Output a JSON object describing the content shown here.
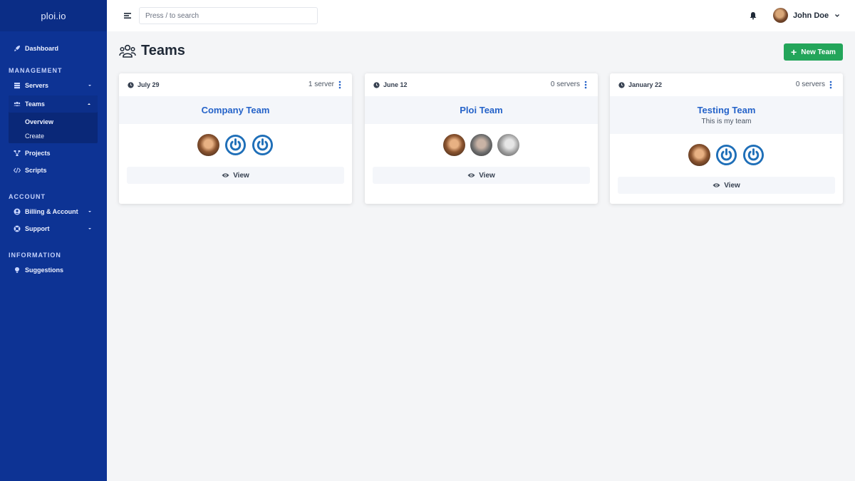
{
  "brand": "ploi.io",
  "search": {
    "placeholder": "Press / to search"
  },
  "user": {
    "name": "John Doe"
  },
  "sidebar": {
    "dashboard": "Dashboard",
    "sections": {
      "management": "MANAGEMENT",
      "account": "ACCOUNT",
      "information": "INFORMATION"
    },
    "servers": "Servers",
    "teams": "Teams",
    "teams_sub": [
      "Overview",
      "Create"
    ],
    "projects": "Projects",
    "scripts": "Scripts",
    "billing": "Billing & Account",
    "support": "Support",
    "suggestions": "Suggestions"
  },
  "page": {
    "title": "Teams",
    "new_button": "New Team"
  },
  "cards": [
    {
      "date": "July 29",
      "servers": "1 server",
      "name": "Company Team",
      "description": "",
      "view": "View",
      "members": [
        "photo",
        "power",
        "power"
      ]
    },
    {
      "date": "June 12",
      "servers": "0 servers",
      "name": "Ploi Team",
      "description": "",
      "view": "View",
      "members": [
        "photo",
        "photo",
        "photo"
      ]
    },
    {
      "date": "January 22",
      "servers": "0 servers",
      "name": "Testing Team",
      "description": "This is my team",
      "view": "View",
      "members": [
        "photo",
        "power",
        "power"
      ]
    }
  ],
  "colors": {
    "sidebar": "#0d3394",
    "accent_blue": "#2563c9",
    "button_green": "#23a55a",
    "power_icon": "#1f6fb8"
  },
  "icons": [
    "menu-icon",
    "bell-icon",
    "chevron-down-icon",
    "users-icon",
    "clock-icon",
    "kebab-icon",
    "eye-icon",
    "power-icon"
  ]
}
